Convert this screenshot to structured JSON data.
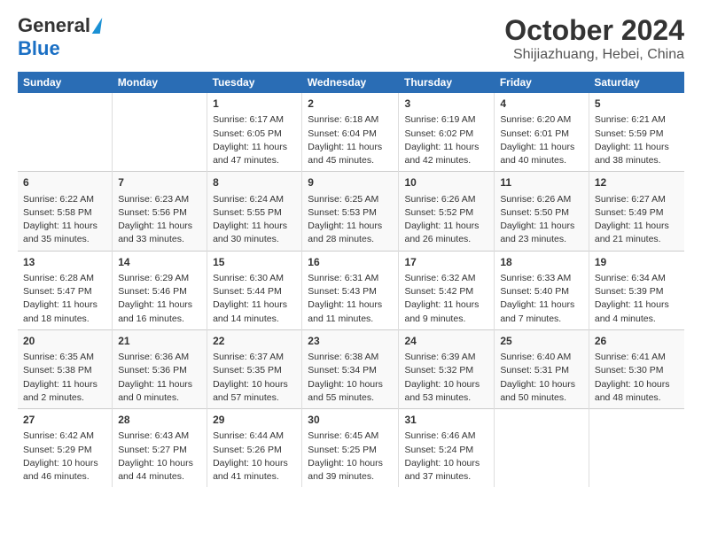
{
  "header": {
    "logo_general": "General",
    "logo_blue": "Blue",
    "month": "October 2024",
    "location": "Shijiazhuang, Hebei, China"
  },
  "columns": [
    "Sunday",
    "Monday",
    "Tuesday",
    "Wednesday",
    "Thursday",
    "Friday",
    "Saturday"
  ],
  "weeks": [
    {
      "days": [
        {
          "num": "",
          "sunrise": "",
          "sunset": "",
          "daylight": ""
        },
        {
          "num": "",
          "sunrise": "",
          "sunset": "",
          "daylight": ""
        },
        {
          "num": "1",
          "sunrise": "Sunrise: 6:17 AM",
          "sunset": "Sunset: 6:05 PM",
          "daylight": "Daylight: 11 hours and 47 minutes."
        },
        {
          "num": "2",
          "sunrise": "Sunrise: 6:18 AM",
          "sunset": "Sunset: 6:04 PM",
          "daylight": "Daylight: 11 hours and 45 minutes."
        },
        {
          "num": "3",
          "sunrise": "Sunrise: 6:19 AM",
          "sunset": "Sunset: 6:02 PM",
          "daylight": "Daylight: 11 hours and 42 minutes."
        },
        {
          "num": "4",
          "sunrise": "Sunrise: 6:20 AM",
          "sunset": "Sunset: 6:01 PM",
          "daylight": "Daylight: 11 hours and 40 minutes."
        },
        {
          "num": "5",
          "sunrise": "Sunrise: 6:21 AM",
          "sunset": "Sunset: 5:59 PM",
          "daylight": "Daylight: 11 hours and 38 minutes."
        }
      ]
    },
    {
      "days": [
        {
          "num": "6",
          "sunrise": "Sunrise: 6:22 AM",
          "sunset": "Sunset: 5:58 PM",
          "daylight": "Daylight: 11 hours and 35 minutes."
        },
        {
          "num": "7",
          "sunrise": "Sunrise: 6:23 AM",
          "sunset": "Sunset: 5:56 PM",
          "daylight": "Daylight: 11 hours and 33 minutes."
        },
        {
          "num": "8",
          "sunrise": "Sunrise: 6:24 AM",
          "sunset": "Sunset: 5:55 PM",
          "daylight": "Daylight: 11 hours and 30 minutes."
        },
        {
          "num": "9",
          "sunrise": "Sunrise: 6:25 AM",
          "sunset": "Sunset: 5:53 PM",
          "daylight": "Daylight: 11 hours and 28 minutes."
        },
        {
          "num": "10",
          "sunrise": "Sunrise: 6:26 AM",
          "sunset": "Sunset: 5:52 PM",
          "daylight": "Daylight: 11 hours and 26 minutes."
        },
        {
          "num": "11",
          "sunrise": "Sunrise: 6:26 AM",
          "sunset": "Sunset: 5:50 PM",
          "daylight": "Daylight: 11 hours and 23 minutes."
        },
        {
          "num": "12",
          "sunrise": "Sunrise: 6:27 AM",
          "sunset": "Sunset: 5:49 PM",
          "daylight": "Daylight: 11 hours and 21 minutes."
        }
      ]
    },
    {
      "days": [
        {
          "num": "13",
          "sunrise": "Sunrise: 6:28 AM",
          "sunset": "Sunset: 5:47 PM",
          "daylight": "Daylight: 11 hours and 18 minutes."
        },
        {
          "num": "14",
          "sunrise": "Sunrise: 6:29 AM",
          "sunset": "Sunset: 5:46 PM",
          "daylight": "Daylight: 11 hours and 16 minutes."
        },
        {
          "num": "15",
          "sunrise": "Sunrise: 6:30 AM",
          "sunset": "Sunset: 5:44 PM",
          "daylight": "Daylight: 11 hours and 14 minutes."
        },
        {
          "num": "16",
          "sunrise": "Sunrise: 6:31 AM",
          "sunset": "Sunset: 5:43 PM",
          "daylight": "Daylight: 11 hours and 11 minutes."
        },
        {
          "num": "17",
          "sunrise": "Sunrise: 6:32 AM",
          "sunset": "Sunset: 5:42 PM",
          "daylight": "Daylight: 11 hours and 9 minutes."
        },
        {
          "num": "18",
          "sunrise": "Sunrise: 6:33 AM",
          "sunset": "Sunset: 5:40 PM",
          "daylight": "Daylight: 11 hours and 7 minutes."
        },
        {
          "num": "19",
          "sunrise": "Sunrise: 6:34 AM",
          "sunset": "Sunset: 5:39 PM",
          "daylight": "Daylight: 11 hours and 4 minutes."
        }
      ]
    },
    {
      "days": [
        {
          "num": "20",
          "sunrise": "Sunrise: 6:35 AM",
          "sunset": "Sunset: 5:38 PM",
          "daylight": "Daylight: 11 hours and 2 minutes."
        },
        {
          "num": "21",
          "sunrise": "Sunrise: 6:36 AM",
          "sunset": "Sunset: 5:36 PM",
          "daylight": "Daylight: 11 hours and 0 minutes."
        },
        {
          "num": "22",
          "sunrise": "Sunrise: 6:37 AM",
          "sunset": "Sunset: 5:35 PM",
          "daylight": "Daylight: 10 hours and 57 minutes."
        },
        {
          "num": "23",
          "sunrise": "Sunrise: 6:38 AM",
          "sunset": "Sunset: 5:34 PM",
          "daylight": "Daylight: 10 hours and 55 minutes."
        },
        {
          "num": "24",
          "sunrise": "Sunrise: 6:39 AM",
          "sunset": "Sunset: 5:32 PM",
          "daylight": "Daylight: 10 hours and 53 minutes."
        },
        {
          "num": "25",
          "sunrise": "Sunrise: 6:40 AM",
          "sunset": "Sunset: 5:31 PM",
          "daylight": "Daylight: 10 hours and 50 minutes."
        },
        {
          "num": "26",
          "sunrise": "Sunrise: 6:41 AM",
          "sunset": "Sunset: 5:30 PM",
          "daylight": "Daylight: 10 hours and 48 minutes."
        }
      ]
    },
    {
      "days": [
        {
          "num": "27",
          "sunrise": "Sunrise: 6:42 AM",
          "sunset": "Sunset: 5:29 PM",
          "daylight": "Daylight: 10 hours and 46 minutes."
        },
        {
          "num": "28",
          "sunrise": "Sunrise: 6:43 AM",
          "sunset": "Sunset: 5:27 PM",
          "daylight": "Daylight: 10 hours and 44 minutes."
        },
        {
          "num": "29",
          "sunrise": "Sunrise: 6:44 AM",
          "sunset": "Sunset: 5:26 PM",
          "daylight": "Daylight: 10 hours and 41 minutes."
        },
        {
          "num": "30",
          "sunrise": "Sunrise: 6:45 AM",
          "sunset": "Sunset: 5:25 PM",
          "daylight": "Daylight: 10 hours and 39 minutes."
        },
        {
          "num": "31",
          "sunrise": "Sunrise: 6:46 AM",
          "sunset": "Sunset: 5:24 PM",
          "daylight": "Daylight: 10 hours and 37 minutes."
        },
        {
          "num": "",
          "sunrise": "",
          "sunset": "",
          "daylight": ""
        },
        {
          "num": "",
          "sunrise": "",
          "sunset": "",
          "daylight": ""
        }
      ]
    }
  ]
}
